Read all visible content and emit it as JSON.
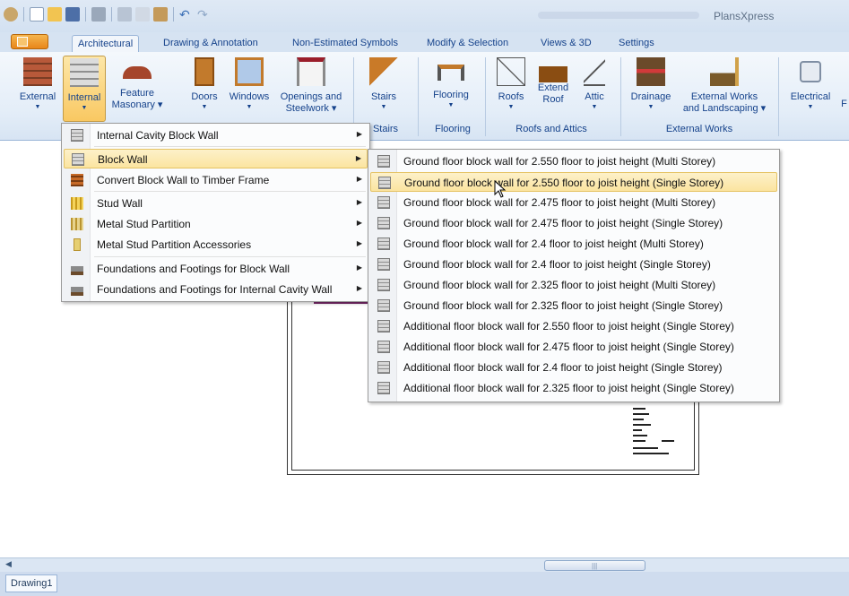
{
  "window": {
    "app_title": "PlansXpress"
  },
  "tabs": [
    "Architectural",
    "Drawing & Annotation",
    "Non-Estimated Symbols",
    "Modify & Selection",
    "Views & 3D",
    "Settings"
  ],
  "ribbon": {
    "buttons": {
      "external": "External",
      "internal": "Internal",
      "feature_masonary_l1": "Feature",
      "feature_masonary_l2": "Masonary",
      "doors": "Doors",
      "windows": "Windows",
      "openings_l1": "Openings and",
      "openings_l2": "Steelwork",
      "stairs": "Stairs",
      "flooring": "Flooring",
      "roofs": "Roofs",
      "extend_roof_l1": "Extend",
      "extend_roof_l2": "Roof",
      "attic": "Attic",
      "drainage": "Drainage",
      "external_works_l1": "External Works",
      "external_works_l2": "and Landscaping",
      "electrical": "Electrical",
      "more": "F"
    },
    "groups": {
      "stairs": "Stairs",
      "flooring": "Flooring",
      "roofs": "Roofs and Attics",
      "external": "External Works"
    }
  },
  "internal_menu": [
    {
      "label": "Internal Cavity Block Wall",
      "icon": "block-wall-icon"
    },
    {
      "label": "Block Wall",
      "icon": "block-wall-icon",
      "highlighted": true
    },
    {
      "label": "Convert Block Wall to Timber Frame",
      "icon": "timber-frame-icon"
    },
    {
      "label": "Stud Wall",
      "icon": "stud-wall-icon"
    },
    {
      "label": "Metal Stud Partition",
      "icon": "metal-stud-icon"
    },
    {
      "label": "Metal Stud Partition Accessories",
      "icon": "accessories-icon"
    },
    {
      "label": "Foundations and Footings for Block Wall",
      "icon": "foundation-icon"
    },
    {
      "label": "Foundations and Footings for Internal Cavity Wall",
      "icon": "foundation-icon"
    }
  ],
  "block_wall_submenu": [
    "Ground floor block wall for 2.550 floor to joist height (Multi Storey)",
    "Ground floor block wall for 2.550 floor to joist height (Single Storey)",
    "Ground floor block wall for 2.475 floor to joist height (Multi Storey)",
    "Ground floor block wall for 2.475 floor to joist height (Single Storey)",
    "Ground floor block wall for 2.4 floor to joist height (Multi Storey)",
    "Ground floor block wall for 2.4 floor to joist height (Single Storey)",
    "Ground floor block wall for 2.325 floor to joist height (Multi Storey)",
    "Ground floor block wall for 2.325 floor to joist height (Single Storey)",
    "Additional floor block wall for 2.550 floor to joist height (Single Storey)",
    "Additional floor block wall for 2.475 floor to joist height (Single Storey)",
    "Additional floor block wall for 2.4 floor to joist height (Single Storey)",
    "Additional floor block wall for 2.325 floor to joist height (Single Storey)"
  ],
  "submenu_highlighted_index": 1,
  "document_tab": "Drawing1",
  "colors": {
    "ribbon": "#e3edf8",
    "highlight": "#fbe4a0",
    "accent": "#15428b"
  }
}
